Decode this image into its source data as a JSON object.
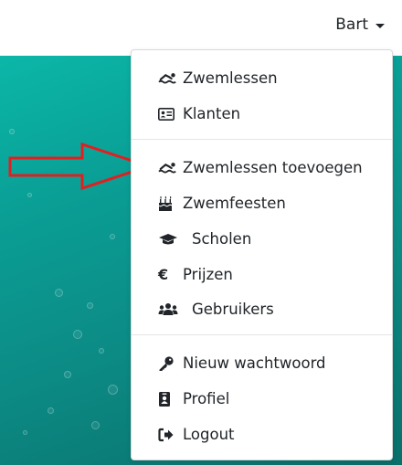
{
  "navbar": {
    "user_name": "Bart"
  },
  "menu": {
    "groups": [
      [
        {
          "label": "Zwemlessen",
          "icon": "swimmer-icon"
        },
        {
          "label": "Klanten",
          "icon": "id-card-icon"
        }
      ],
      [
        {
          "label": "Zwemlessen toevoegen",
          "icon": "swimmer-icon"
        },
        {
          "label": "Zwemfeesten",
          "icon": "birthday-cake-icon"
        },
        {
          "label": "Scholen",
          "icon": "graduation-cap-icon"
        },
        {
          "label": "Prijzen",
          "icon": "euro-icon"
        },
        {
          "label": "Gebruikers",
          "icon": "users-icon"
        }
      ],
      [
        {
          "label": "Nieuw wachtwoord",
          "icon": "key-icon"
        },
        {
          "label": "Profiel",
          "icon": "id-badge-icon"
        },
        {
          "label": "Logout",
          "icon": "sign-out-icon"
        }
      ]
    ]
  },
  "annotation": {
    "arrow_color": "#e02020"
  },
  "colors": {
    "hero_top": "#0bb7a8",
    "hero_bottom": "#0a6f6a"
  }
}
